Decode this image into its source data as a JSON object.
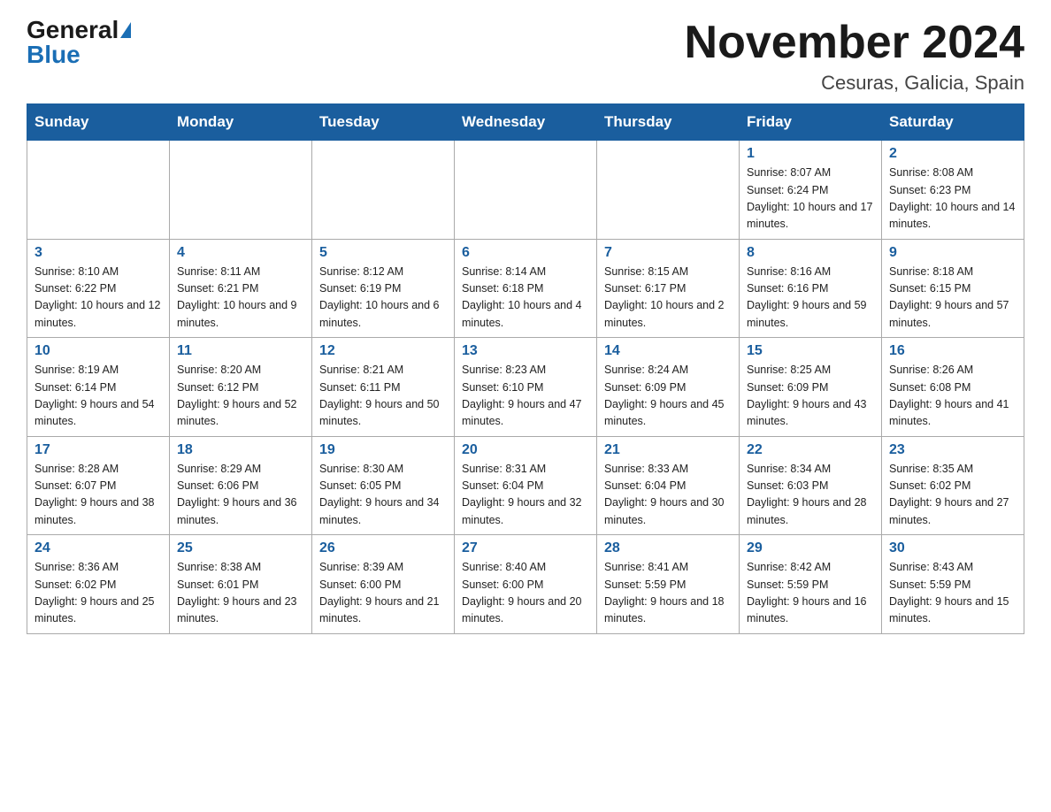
{
  "header": {
    "logo_general": "General",
    "logo_blue": "Blue",
    "month_title": "November 2024",
    "location": "Cesuras, Galicia, Spain"
  },
  "weekdays": [
    "Sunday",
    "Monday",
    "Tuesday",
    "Wednesday",
    "Thursday",
    "Friday",
    "Saturday"
  ],
  "weeks": [
    [
      {
        "day": "",
        "info": ""
      },
      {
        "day": "",
        "info": ""
      },
      {
        "day": "",
        "info": ""
      },
      {
        "day": "",
        "info": ""
      },
      {
        "day": "",
        "info": ""
      },
      {
        "day": "1",
        "info": "Sunrise: 8:07 AM\nSunset: 6:24 PM\nDaylight: 10 hours and 17 minutes."
      },
      {
        "day": "2",
        "info": "Sunrise: 8:08 AM\nSunset: 6:23 PM\nDaylight: 10 hours and 14 minutes."
      }
    ],
    [
      {
        "day": "3",
        "info": "Sunrise: 8:10 AM\nSunset: 6:22 PM\nDaylight: 10 hours and 12 minutes."
      },
      {
        "day": "4",
        "info": "Sunrise: 8:11 AM\nSunset: 6:21 PM\nDaylight: 10 hours and 9 minutes."
      },
      {
        "day": "5",
        "info": "Sunrise: 8:12 AM\nSunset: 6:19 PM\nDaylight: 10 hours and 6 minutes."
      },
      {
        "day": "6",
        "info": "Sunrise: 8:14 AM\nSunset: 6:18 PM\nDaylight: 10 hours and 4 minutes."
      },
      {
        "day": "7",
        "info": "Sunrise: 8:15 AM\nSunset: 6:17 PM\nDaylight: 10 hours and 2 minutes."
      },
      {
        "day": "8",
        "info": "Sunrise: 8:16 AM\nSunset: 6:16 PM\nDaylight: 9 hours and 59 minutes."
      },
      {
        "day": "9",
        "info": "Sunrise: 8:18 AM\nSunset: 6:15 PM\nDaylight: 9 hours and 57 minutes."
      }
    ],
    [
      {
        "day": "10",
        "info": "Sunrise: 8:19 AM\nSunset: 6:14 PM\nDaylight: 9 hours and 54 minutes."
      },
      {
        "day": "11",
        "info": "Sunrise: 8:20 AM\nSunset: 6:12 PM\nDaylight: 9 hours and 52 minutes."
      },
      {
        "day": "12",
        "info": "Sunrise: 8:21 AM\nSunset: 6:11 PM\nDaylight: 9 hours and 50 minutes."
      },
      {
        "day": "13",
        "info": "Sunrise: 8:23 AM\nSunset: 6:10 PM\nDaylight: 9 hours and 47 minutes."
      },
      {
        "day": "14",
        "info": "Sunrise: 8:24 AM\nSunset: 6:09 PM\nDaylight: 9 hours and 45 minutes."
      },
      {
        "day": "15",
        "info": "Sunrise: 8:25 AM\nSunset: 6:09 PM\nDaylight: 9 hours and 43 minutes."
      },
      {
        "day": "16",
        "info": "Sunrise: 8:26 AM\nSunset: 6:08 PM\nDaylight: 9 hours and 41 minutes."
      }
    ],
    [
      {
        "day": "17",
        "info": "Sunrise: 8:28 AM\nSunset: 6:07 PM\nDaylight: 9 hours and 38 minutes."
      },
      {
        "day": "18",
        "info": "Sunrise: 8:29 AM\nSunset: 6:06 PM\nDaylight: 9 hours and 36 minutes."
      },
      {
        "day": "19",
        "info": "Sunrise: 8:30 AM\nSunset: 6:05 PM\nDaylight: 9 hours and 34 minutes."
      },
      {
        "day": "20",
        "info": "Sunrise: 8:31 AM\nSunset: 6:04 PM\nDaylight: 9 hours and 32 minutes."
      },
      {
        "day": "21",
        "info": "Sunrise: 8:33 AM\nSunset: 6:04 PM\nDaylight: 9 hours and 30 minutes."
      },
      {
        "day": "22",
        "info": "Sunrise: 8:34 AM\nSunset: 6:03 PM\nDaylight: 9 hours and 28 minutes."
      },
      {
        "day": "23",
        "info": "Sunrise: 8:35 AM\nSunset: 6:02 PM\nDaylight: 9 hours and 27 minutes."
      }
    ],
    [
      {
        "day": "24",
        "info": "Sunrise: 8:36 AM\nSunset: 6:02 PM\nDaylight: 9 hours and 25 minutes."
      },
      {
        "day": "25",
        "info": "Sunrise: 8:38 AM\nSunset: 6:01 PM\nDaylight: 9 hours and 23 minutes."
      },
      {
        "day": "26",
        "info": "Sunrise: 8:39 AM\nSunset: 6:00 PM\nDaylight: 9 hours and 21 minutes."
      },
      {
        "day": "27",
        "info": "Sunrise: 8:40 AM\nSunset: 6:00 PM\nDaylight: 9 hours and 20 minutes."
      },
      {
        "day": "28",
        "info": "Sunrise: 8:41 AM\nSunset: 5:59 PM\nDaylight: 9 hours and 18 minutes."
      },
      {
        "day": "29",
        "info": "Sunrise: 8:42 AM\nSunset: 5:59 PM\nDaylight: 9 hours and 16 minutes."
      },
      {
        "day": "30",
        "info": "Sunrise: 8:43 AM\nSunset: 5:59 PM\nDaylight: 9 hours and 15 minutes."
      }
    ]
  ]
}
